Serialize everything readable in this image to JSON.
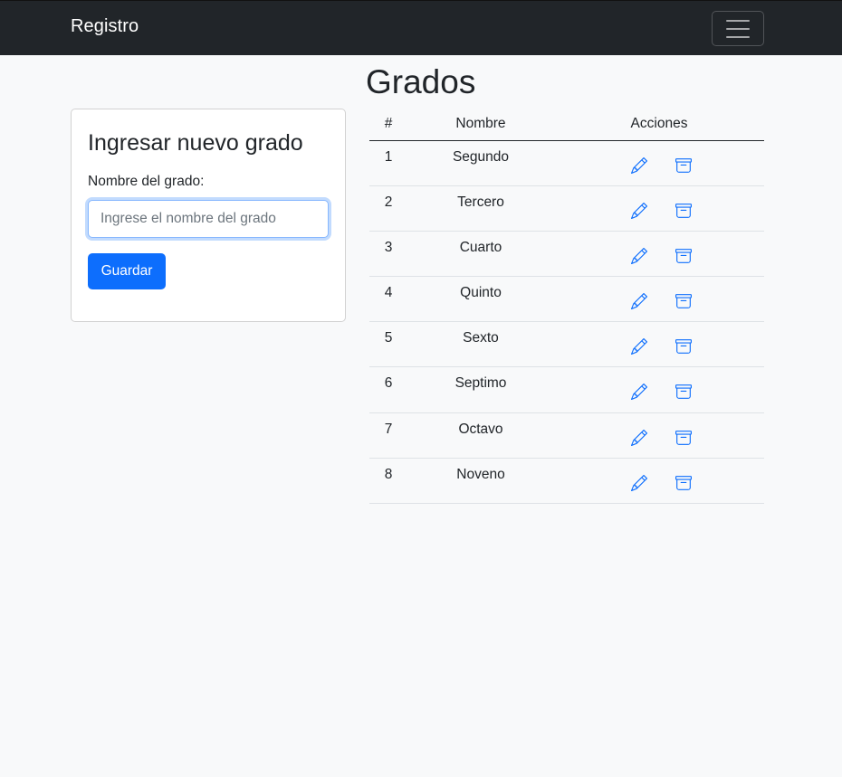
{
  "navbar": {
    "brand": "Registro",
    "toggler_icon": "menu-icon"
  },
  "page": {
    "title": "Grados"
  },
  "form": {
    "title": "Ingresar nuevo grado",
    "label": "Nombre del grado:",
    "placeholder": "Ingrese el nombre del grado",
    "value": "",
    "save_label": "Guardar"
  },
  "table": {
    "headers": [
      "#",
      "Nombre",
      "Acciones"
    ],
    "rows": [
      {
        "num": "1",
        "name": "Segundo"
      },
      {
        "num": "2",
        "name": "Tercero"
      },
      {
        "num": "3",
        "name": "Cuarto"
      },
      {
        "num": "4",
        "name": "Quinto"
      },
      {
        "num": "5",
        "name": "Sexto"
      },
      {
        "num": "6",
        "name": "Septimo"
      },
      {
        "num": "7",
        "name": "Octavo"
      },
      {
        "num": "8",
        "name": "Noveno"
      }
    ],
    "edit_icon": "pencil-icon",
    "delete_icon": "archive-icon"
  },
  "colors": {
    "navbar_bg": "#212529",
    "primary": "#0d6efd",
    "page_bg": "#f8f9fa"
  }
}
